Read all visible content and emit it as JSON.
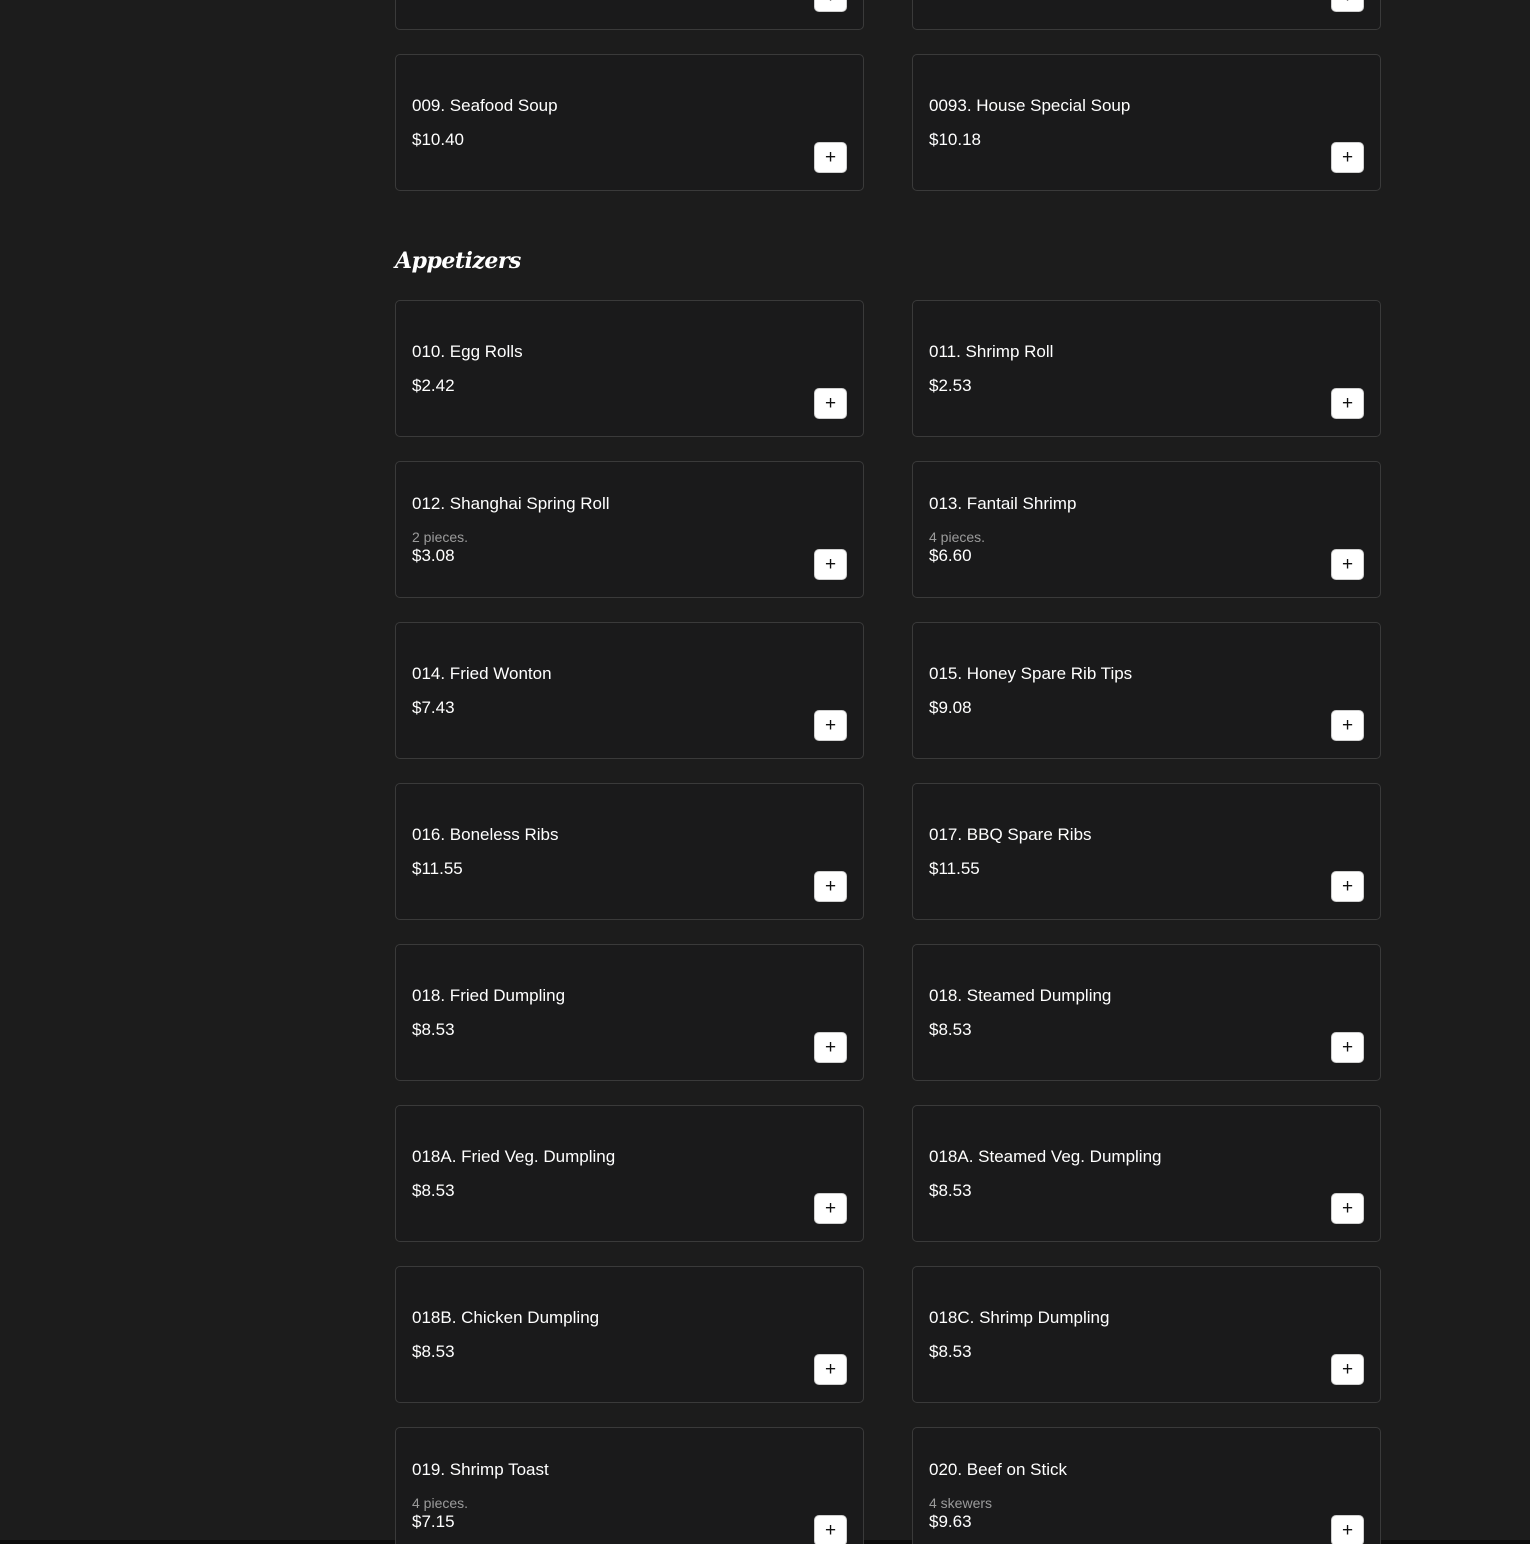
{
  "add_label": "+",
  "soups_partial": [
    {
      "name": "",
      "desc": "",
      "price": ""
    },
    {
      "name": "",
      "desc": "",
      "price": ""
    },
    {
      "name": "009. Seafood Soup",
      "desc": "",
      "price": "$10.40"
    },
    {
      "name": "0093. House Special Soup",
      "desc": "",
      "price": "$10.18"
    }
  ],
  "appetizers": {
    "title": "Appetizers",
    "items": [
      {
        "name": "010. Egg Rolls",
        "desc": "",
        "price": "$2.42"
      },
      {
        "name": "011. Shrimp Roll",
        "desc": "",
        "price": "$2.53"
      },
      {
        "name": "012. Shanghai Spring Roll",
        "desc": "2 pieces.",
        "price": "$3.08"
      },
      {
        "name": "013. Fantail Shrimp",
        "desc": "4 pieces.",
        "price": "$6.60"
      },
      {
        "name": "014. Fried Wonton",
        "desc": "",
        "price": "$7.43"
      },
      {
        "name": "015. Honey Spare Rib Tips",
        "desc": "",
        "price": "$9.08"
      },
      {
        "name": "016. Boneless Ribs",
        "desc": "",
        "price": "$11.55"
      },
      {
        "name": "017. BBQ Spare Ribs",
        "desc": "",
        "price": "$11.55"
      },
      {
        "name": "018. Fried Dumpling",
        "desc": "",
        "price": "$8.53"
      },
      {
        "name": "018. Steamed Dumpling",
        "desc": "",
        "price": "$8.53"
      },
      {
        "name": "018A. Fried Veg. Dumpling",
        "desc": "",
        "price": "$8.53"
      },
      {
        "name": "018A. Steamed Veg. Dumpling",
        "desc": "",
        "price": "$8.53"
      },
      {
        "name": "018B. Chicken Dumpling",
        "desc": "",
        "price": "$8.53"
      },
      {
        "name": "018C. Shrimp Dumpling",
        "desc": "",
        "price": "$8.53"
      },
      {
        "name": "019. Shrimp Toast",
        "desc": "4 pieces.",
        "price": "$7.15"
      },
      {
        "name": "020. Beef on Stick",
        "desc": "4 skewers",
        "price": "$9.63"
      }
    ]
  }
}
